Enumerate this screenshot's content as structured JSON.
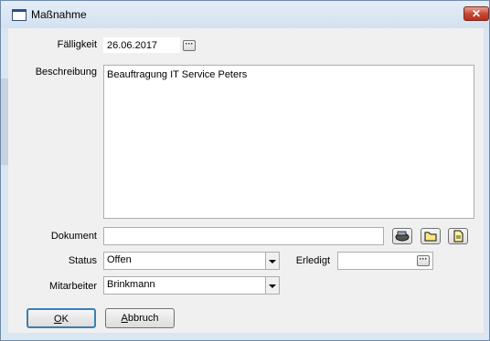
{
  "window": {
    "title": "Maßnahme",
    "close_symbol": "✕"
  },
  "form": {
    "faelligkeit_label": "Fälligkeit",
    "faelligkeit_value": "26.06.2017",
    "beschreibung_label": "Beschreibung",
    "beschreibung_value": "Beauftragung IT Service Peters",
    "dokument_label": "Dokument",
    "dokument_value": "",
    "status_label": "Status",
    "status_value": "Offen",
    "erledigt_label": "Erledigt",
    "erledigt_value": "",
    "mitarbeiter_label": "Mitarbeiter",
    "mitarbeiter_value": "Brinkmann",
    "dots": "···"
  },
  "icons": {
    "scan": "scanner-icon",
    "folder": "folder-icon",
    "document": "document-icon"
  },
  "buttons": {
    "ok_mnemonic": "O",
    "ok_rest": "K",
    "abbruch_mnemonic": "A",
    "abbruch_rest": "bbruch"
  }
}
